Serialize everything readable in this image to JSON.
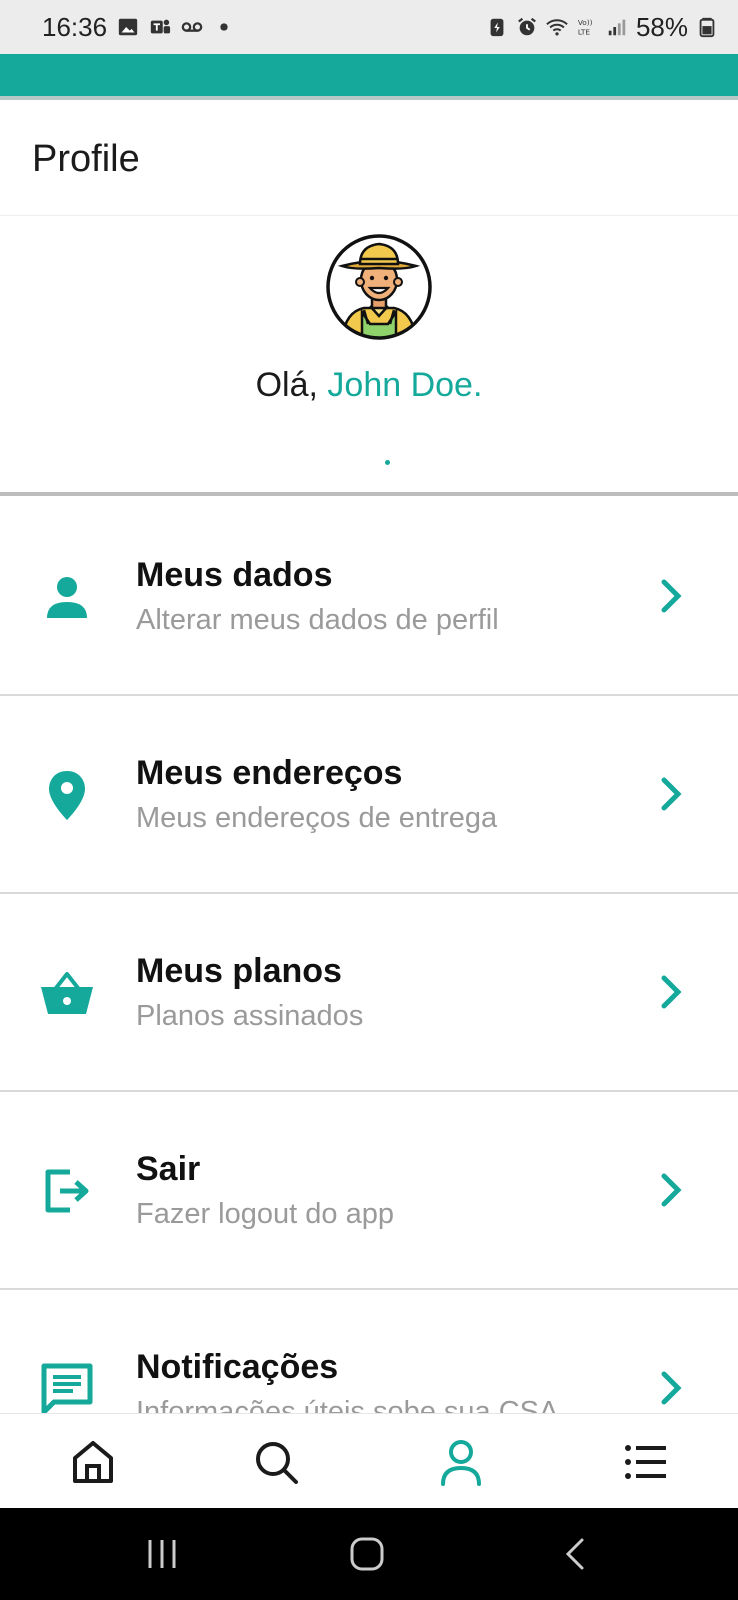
{
  "status_bar": {
    "time": "16:36",
    "battery": "58%",
    "icons_left": [
      "image-icon",
      "teams-icon",
      "voicemail-icon",
      "dot-icon"
    ],
    "icons_right": [
      "battery-saver-icon",
      "alarm-icon",
      "wifi-icon",
      "volte-icon",
      "signal-icon",
      "battery-icon"
    ]
  },
  "colors": {
    "accent": "#14a99a",
    "status_bar_bg": "#ececec",
    "nav_bar_bg": "#000000",
    "subtitle": "#9a9a9a"
  },
  "header": {
    "title": "Profile"
  },
  "profile": {
    "greeting_prefix": "Olá, ",
    "user_name": "John Doe.",
    "avatar_icon": "farmer-avatar-icon"
  },
  "menu": [
    {
      "icon": "person-icon",
      "title": "Meus dados",
      "subtitle": "Alterar meus dados de perfil"
    },
    {
      "icon": "location-pin-icon",
      "title": "Meus endereços",
      "subtitle": "Meus endereços de entrega"
    },
    {
      "icon": "basket-icon",
      "title": "Meus planos",
      "subtitle": "Planos assinados"
    },
    {
      "icon": "logout-icon",
      "title": "Sair",
      "subtitle": "Fazer logout do app"
    },
    {
      "icon": "message-icon",
      "title": "Notificações",
      "subtitle": "Informações úteis sobe sua CSA"
    }
  ],
  "bottom_nav": {
    "items": [
      "home-icon",
      "search-icon",
      "profile-icon",
      "menu-list-icon"
    ],
    "active": "profile-icon"
  },
  "system_nav": {
    "items": [
      "recents-icon",
      "home-circle-icon",
      "back-icon"
    ]
  }
}
